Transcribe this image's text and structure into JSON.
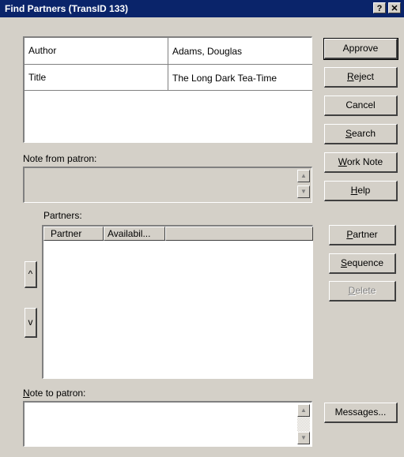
{
  "window": {
    "title": "Find Partners (TransID 133)",
    "help_button": "?",
    "close_button": "✕"
  },
  "record": {
    "rows": [
      {
        "label": "Author",
        "value": "Adams, Douglas"
      },
      {
        "label": "Title",
        "value": "The Long Dark Tea-Time"
      }
    ]
  },
  "buttons": {
    "approve": "Approve",
    "reject": {
      "mnemonic": "R",
      "rest": "eject"
    },
    "cancel": "Cancel",
    "search": {
      "mnemonic": "S",
      "rest": "earch"
    },
    "work_note": {
      "mnemonic": "W",
      "rest": "ork Note"
    },
    "help": {
      "mnemonic": "H",
      "rest": "elp"
    },
    "partner": {
      "mnemonic": "P",
      "rest": "artner"
    },
    "sequence": {
      "mnemonic": "S",
      "rest": "equence"
    },
    "delete": {
      "mnemonic": "D",
      "rest": "elete"
    },
    "messages": "Messages...",
    "move_up": "^",
    "move_down": "v"
  },
  "note_from_patron": {
    "label": "Note from patron:",
    "value": ""
  },
  "partners": {
    "label": "Partners:",
    "columns": [
      "Partner",
      "Availabil..."
    ],
    "rows": []
  },
  "note_to_patron": {
    "label_mnemonic": "N",
    "label_rest": "ote to patron:",
    "value": ""
  },
  "scroll_arrows": {
    "up": "▲",
    "down": "▼"
  }
}
